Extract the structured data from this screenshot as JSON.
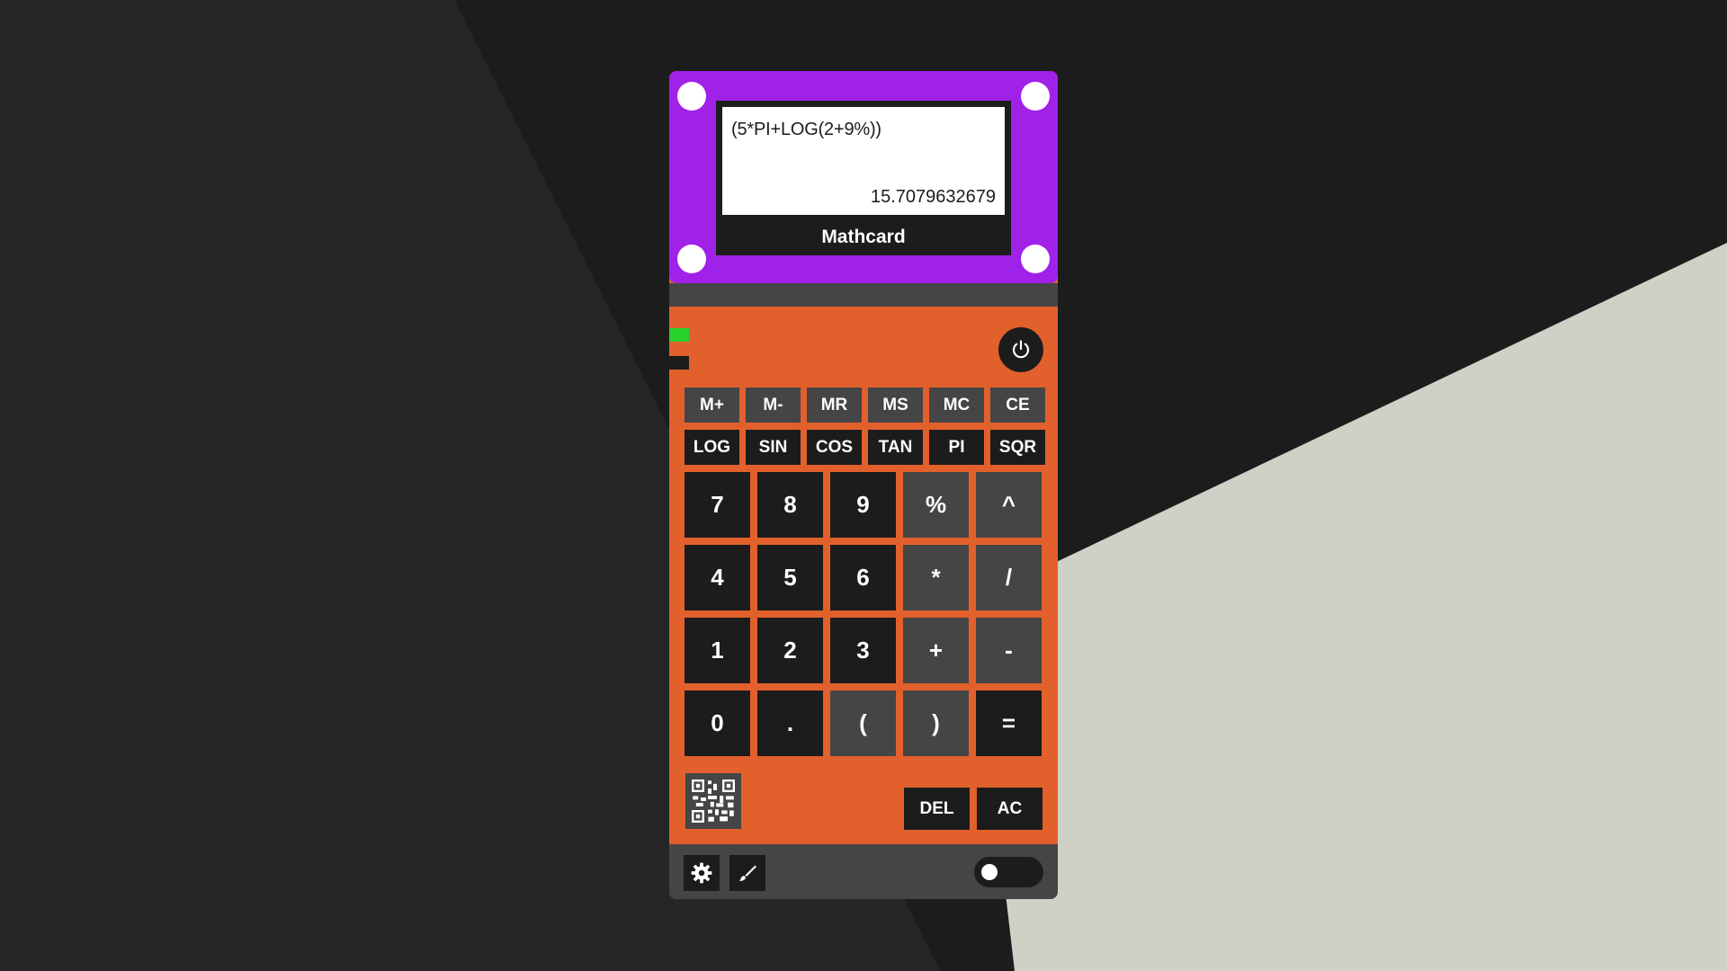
{
  "app": {
    "brand": "Mathcard"
  },
  "display": {
    "expression": "(5*PI+LOG(2+9%))",
    "result": "15.7079632679"
  },
  "function_rows": [
    [
      "M+",
      "M-",
      "MR",
      "MS",
      "MC",
      "CE"
    ],
    [
      "LOG",
      "SIN",
      "COS",
      "TAN",
      "PI",
      "SQR"
    ]
  ],
  "keypad": [
    [
      "7",
      "8",
      "9",
      "%",
      "^"
    ],
    [
      "4",
      "5",
      "6",
      "*",
      "/"
    ],
    [
      "1",
      "2",
      "3",
      "+",
      "-"
    ],
    [
      "0",
      ".",
      "(",
      ")",
      "="
    ]
  ],
  "bottom_keys": {
    "del": "DEL",
    "ac": "AC"
  },
  "icons": {
    "power": "power-icon",
    "qr": "qr-code-icon",
    "settings": "gear-icon",
    "brush": "brush-icon"
  },
  "toggle": {
    "on": false
  },
  "colors": {
    "body": "#e2602c",
    "screen_frame": "#a021e8",
    "key_dark": "#1c1c1c",
    "key_gray": "#454545",
    "led_green": "#29d12d"
  }
}
